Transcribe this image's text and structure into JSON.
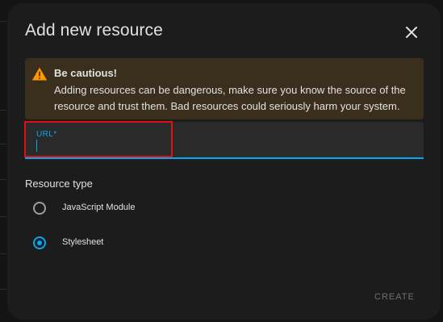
{
  "dialog": {
    "title": "Add new resource",
    "close_icon": "close-icon"
  },
  "alert": {
    "icon": "warning-icon",
    "title": "Be cautious!",
    "text": "Adding resources can be dangerous, make sure you know the source of the resource and trust them. Bad resources could seriously harm your system.",
    "accent_color": "#ff9800",
    "background_color": "#3a2f1c"
  },
  "url_field": {
    "label": "URL*",
    "value": "",
    "accent_color": "#03a9f4"
  },
  "resource_type": {
    "label": "Resource type",
    "options": [
      {
        "label": "JavaScript Module",
        "checked": false
      },
      {
        "label": "Stylesheet",
        "checked": true
      }
    ]
  },
  "actions": {
    "create_label": "CREATE"
  }
}
